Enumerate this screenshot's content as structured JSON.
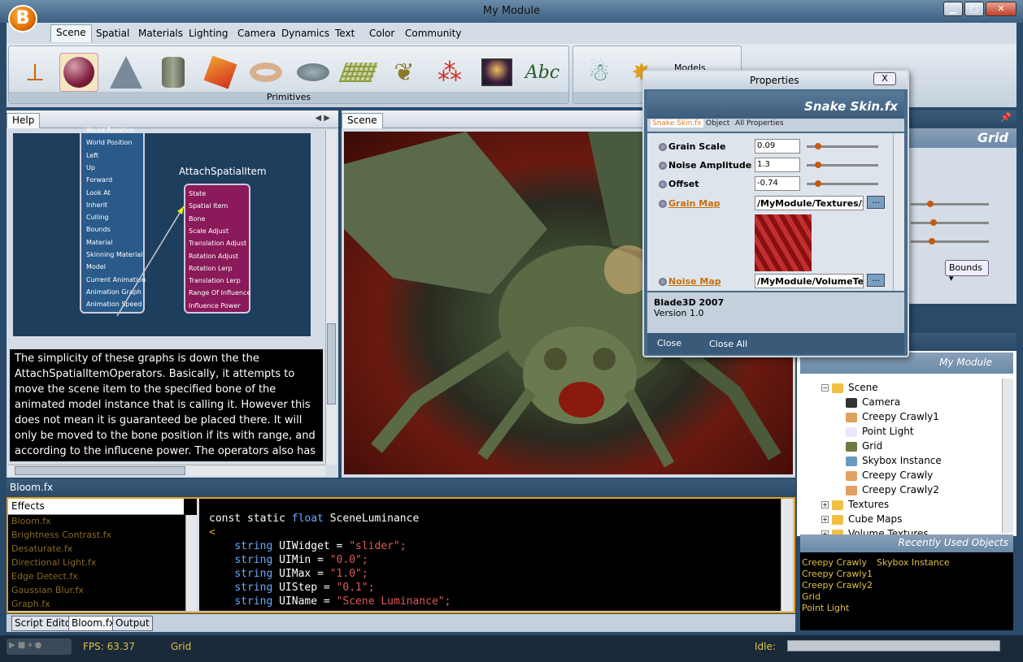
{
  "window": {
    "title": "My Module",
    "logo": "B"
  },
  "menu": [
    "Scene",
    "Spatial",
    "Materials",
    "Lighting",
    "Camera",
    "Dynamics",
    "Text",
    "Color",
    "Community"
  ],
  "ribbon": {
    "primitives_label": "Primitives",
    "models_label": "Models",
    "models_group_short": "M",
    "text_icon": "Abc"
  },
  "help": {
    "tab": "Help",
    "graph_title": "AttachSpatialItem",
    "left_node_items": [
      "World Rotation",
      "World Position",
      "Left",
      "Up",
      "Forward",
      "Look At",
      "Inherit",
      "Culling",
      "Bounds",
      "Material",
      "Skinning Material",
      "Model",
      "Current Animation",
      "Animation Graph",
      "Animation Speed"
    ],
    "right_node_items": [
      "State",
      "Spatial Item",
      "Bone",
      "Scale Adjust",
      "Translation Adjust",
      "Rotation Adjust",
      "Rotation Lerp",
      "Translation Lerp",
      "Range Of Influence",
      "Influence Power"
    ],
    "text": "The simplicity of these graphs is down the the AttachSpatialItemOperators. Basically, it attempts to move the scene item to the specified bone of the animated model instance that is calling it. However this does not mean it is guaranteed be placed there. It will only be moved to the bone position if its with range, and according to the influcene power. The operators also has"
  },
  "scene": {
    "tab": "Scene"
  },
  "bottom": {
    "title": "Bloom.fx",
    "effects_header": "Effects",
    "effects": [
      "Bloom.fx",
      "Brightness Contrast.fx",
      "Desaturate.fx",
      "Directional Light.fx",
      "Edge Detect.fx",
      "Gaussian Blur.fx",
      "Graph.fx"
    ],
    "code_lines": [
      {
        "a": "const static ",
        "b": "float",
        "c": " SceneLuminance",
        "s": ""
      },
      {
        "a": "<",
        "b": "",
        "c": "",
        "s": ""
      },
      {
        "a": "    ",
        "b": "string",
        "c": " UIWidget = ",
        "s": "\"slider\";"
      },
      {
        "a": "    ",
        "b": "string",
        "c": " UIMin = ",
        "s": "\"0.0\";"
      },
      {
        "a": "    ",
        "b": "string",
        "c": " UIMax = ",
        "s": "\"1.0\";"
      },
      {
        "a": "    ",
        "b": "string",
        "c": " UIStep = ",
        "s": "\"0.1\";"
      },
      {
        "a": "    ",
        "b": "string",
        "c": " UIName = ",
        "s": "\"Scene Luminance\";"
      }
    ],
    "tabs": [
      "Script Editor",
      "Bloom.fx",
      "Output"
    ]
  },
  "status": {
    "fps": "FPS: 63.37",
    "selection": "Grid",
    "state": "Idle:"
  },
  "right": {
    "title": "Grid",
    "bounds": "Bounds",
    "module": "My Module",
    "tree": [
      {
        "label": "Scene",
        "icon": "folder-icon",
        "level": 0
      },
      {
        "label": "Camera",
        "icon": "camera-icon",
        "level": 1
      },
      {
        "label": "Creepy Crawly1",
        "icon": "model-icon",
        "level": 1
      },
      {
        "label": "Point Light",
        "icon": "bulb-icon",
        "level": 1
      },
      {
        "label": "Grid",
        "icon": "grid-icon",
        "level": 1
      },
      {
        "label": "Skybox Instance",
        "icon": "skybox-icon",
        "level": 1
      },
      {
        "label": "Creepy Crawly",
        "icon": "model-icon",
        "level": 1
      },
      {
        "label": "Creepy Crawly2",
        "icon": "model-icon",
        "level": 1
      },
      {
        "label": "Textures",
        "icon": "folder-icon",
        "level": 0
      },
      {
        "label": "Cube Maps",
        "icon": "folder-icon",
        "level": 0
      },
      {
        "label": "Volume Textures",
        "icon": "folder-icon",
        "level": 0
      }
    ],
    "recent_title": "Recently Used Objects",
    "recent_col1": [
      "Creepy Crawly",
      "Creepy Crawly1",
      "Creepy Crawly2",
      "Grid",
      "Point Light"
    ],
    "recent_col2": [
      "Skybox Instance"
    ]
  },
  "properties": {
    "title": "Properties",
    "close_x": "X",
    "header": "Snake Skin.fx",
    "tabs": [
      "Snake Skin.fx",
      "Object",
      "All Properties"
    ],
    "rows": [
      {
        "label": "Grain Scale",
        "value": "0.09"
      },
      {
        "label": "Noise Amplitude",
        "value": "1.3"
      },
      {
        "label": "Offset",
        "value": "-0.74"
      }
    ],
    "grain_map": {
      "label": "Grain Map",
      "value": "/MyModule/Textures/S"
    },
    "noise_map": {
      "label": "Noise Map",
      "value": "/MyModule/VolumeTex"
    },
    "browse": "...",
    "footer_title": "Blade3D 2007",
    "footer_version": "Version 1.0",
    "close": "Close",
    "close_all": "Close All"
  }
}
